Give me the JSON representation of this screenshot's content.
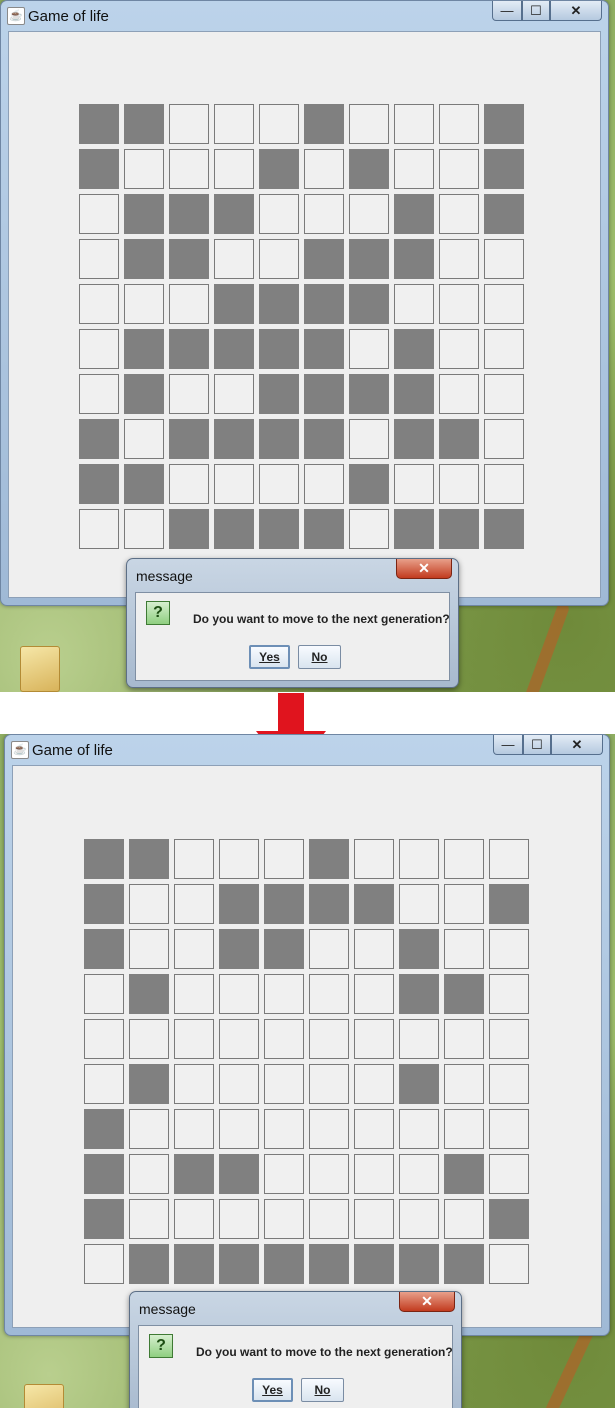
{
  "window": {
    "title": "Game of life",
    "buttons": {
      "minimize": "—",
      "maximize": "☐",
      "close": "✕"
    }
  },
  "dialog": {
    "title": "message",
    "close": "✕",
    "icon": "?",
    "message": "Do you want to move to the next generation?",
    "yes_label": "Yes",
    "no_label": "No"
  },
  "colors": {
    "alive": "#808080",
    "dead": "#f0f0f0",
    "arrow": "#e0141e"
  },
  "grids": {
    "before": [
      "1100010001",
      "1000101001",
      "0111000101",
      "0110011100",
      "0001111000",
      "0111110100",
      "0100111100",
      "1011110110",
      "1100001000",
      "0011110111"
    ],
    "after": [
      "1100010000",
      "1001111001",
      "1001100100",
      "0100000110",
      "0000000000",
      "0100000100",
      "1000000000",
      "1011000010",
      "1000000001",
      "0111111110"
    ]
  }
}
